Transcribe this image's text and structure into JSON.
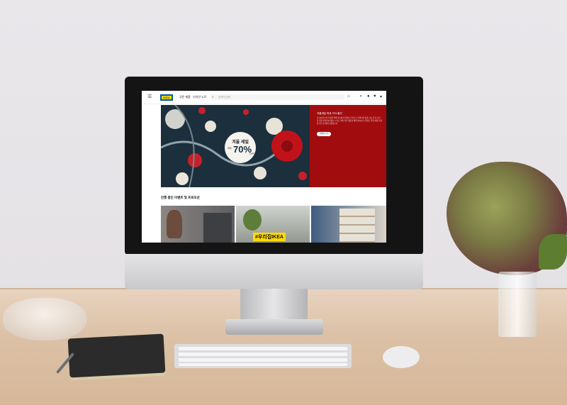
{
  "site": {
    "nav": [
      "국민 제품",
      "디자인 노트"
    ],
    "search_placeholder": "검색어 입력",
    "brand": "IKEA",
    "icons": [
      "menu-icon",
      "search-icon",
      "location-icon",
      "truck-icon",
      "user-icon",
      "heart-icon",
      "cart-icon"
    ]
  },
  "hero": {
    "badge_title": "겨울 세일",
    "badge_prefix": "최대",
    "badge_percent": "70%",
    "badge_suffix": "OFF",
    "panel_title": "겨울세일 최대 70% 할인",
    "panel_body": "이 이야기로의 특정을 위해 가능성과 번영된 가격으로 인테리어 상품 기능 을 더 요긴을 위한 인테리어 제품 시 겸도 이케 적인 제품과 혜택 제시를 수 있어요 행복 제품가 활용 필요 한 혜택 다양합니다",
    "button_label": "자세히 보기"
  },
  "section": {
    "title": "진행 중인 이벤트 및 프로모션",
    "hashtag": "#우리집IKEA"
  }
}
